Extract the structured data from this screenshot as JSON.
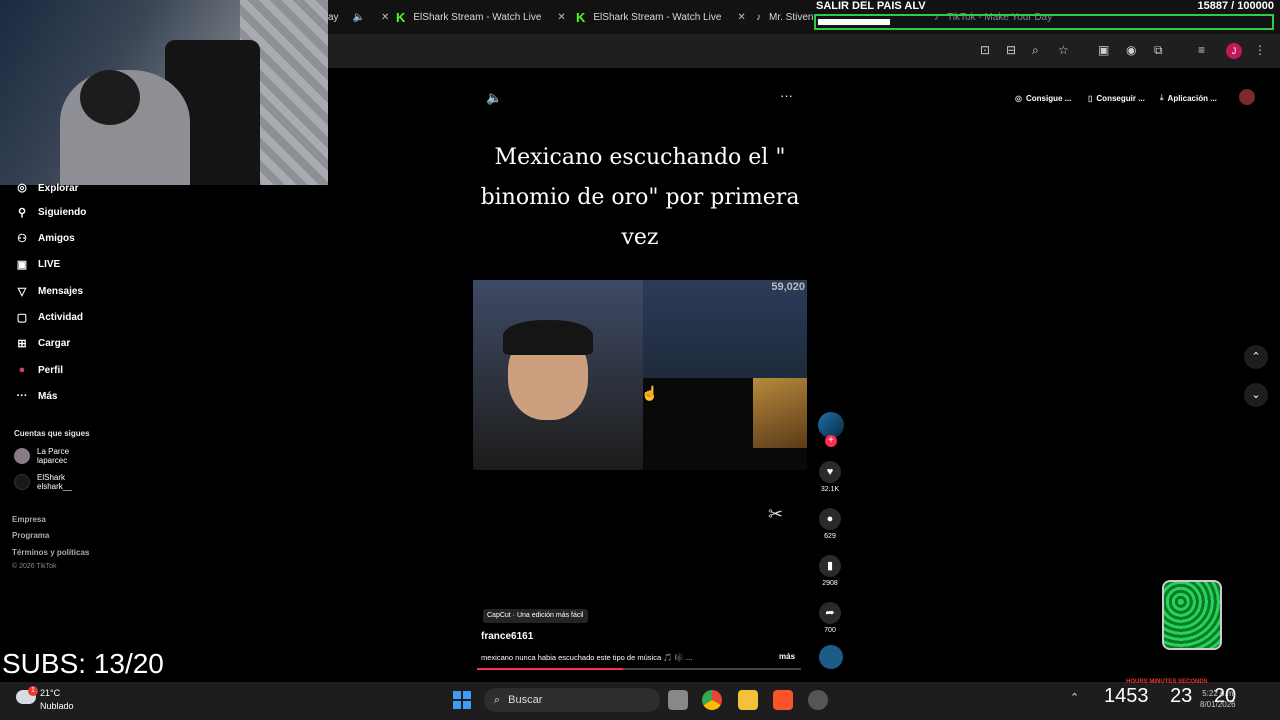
{
  "browser": {
    "tabs": [
      {
        "label": "ay",
        "kind": "partial"
      },
      {
        "label": "ElShark Stream - Watch Live",
        "kind": "kick"
      },
      {
        "label": "ElShark Stream - Watch Live",
        "kind": "kick"
      },
      {
        "label": "Mr. Stiven",
        "kind": "tiktok"
      },
      {
        "label": "TikTok - Make Your Day",
        "kind": "tiktok"
      }
    ],
    "profile_initial": "J"
  },
  "overlay": {
    "goal_title": "SALIR DEL PAIS ALV",
    "goal_count": "15887 / 100000",
    "goal_progress": 0.159,
    "subs_label": "SUBS: 13/20",
    "timer": {
      "hours": "14",
      "minutes": "53",
      "seconds": "23",
      "extra": "20",
      "labels": "HOURS  MINUTES  SECONDS"
    }
  },
  "sidebar": {
    "items": [
      {
        "label": "Explorar",
        "icon": "compass-icon",
        "glyph": "◎"
      },
      {
        "label": "Siguiendo",
        "icon": "following-icon",
        "glyph": "⚲"
      },
      {
        "label": "Amigos",
        "icon": "friends-icon",
        "glyph": "⚇"
      },
      {
        "label": "LIVE",
        "icon": "live-icon",
        "glyph": "▣"
      },
      {
        "label": "Mensajes",
        "icon": "messages-icon",
        "glyph": "▽"
      },
      {
        "label": "Actividad",
        "icon": "activity-icon",
        "glyph": "▢"
      },
      {
        "label": "Cargar",
        "icon": "upload-icon",
        "glyph": "⊞"
      },
      {
        "label": "Perfil",
        "icon": "profile-icon",
        "glyph": "●"
      },
      {
        "label": "Más",
        "icon": "more-icon",
        "glyph": "···"
      }
    ],
    "following_label": "Cuentas que sigues",
    "following": [
      {
        "name": "La Parce",
        "handle": "laparcec"
      },
      {
        "name": "ElShark",
        "handle": "elshark__"
      }
    ],
    "footer": [
      "Empresa",
      "Programa",
      "Términos y políticas"
    ],
    "copyright": "© 2026 TikTok"
  },
  "top_actions": [
    {
      "label": "Consigue ...",
      "glyph": "◎"
    },
    {
      "label": "Conseguir ...",
      "glyph": "▯"
    },
    {
      "label": "Aplicación ...",
      "glyph": "⤓"
    }
  ],
  "video": {
    "caption": "Mexicano escuchando el \" binomio de oro\" por primera vez",
    "inset_views": "59,020",
    "likes": "32.1K",
    "comments": "629",
    "saves": "2908",
    "shares": "700",
    "capcut_label": "CapCut · Una edición más fácil",
    "author": "france6161",
    "description": "mexicano nunca habia escuchado este tipo de música 🎵 🎼 ...",
    "more_label": "más",
    "progress": 0.45
  },
  "taskbar": {
    "temperature": "21°C",
    "condition": "Nublado",
    "weather_badge": "1",
    "search_placeholder": "Buscar",
    "time": "5:22 p.m.",
    "date": "8/01/2026"
  },
  "colors": {
    "tiktok_red": "#fe2c55",
    "kick_green": "#53fc18",
    "goal_border": "#2ecc40"
  }
}
